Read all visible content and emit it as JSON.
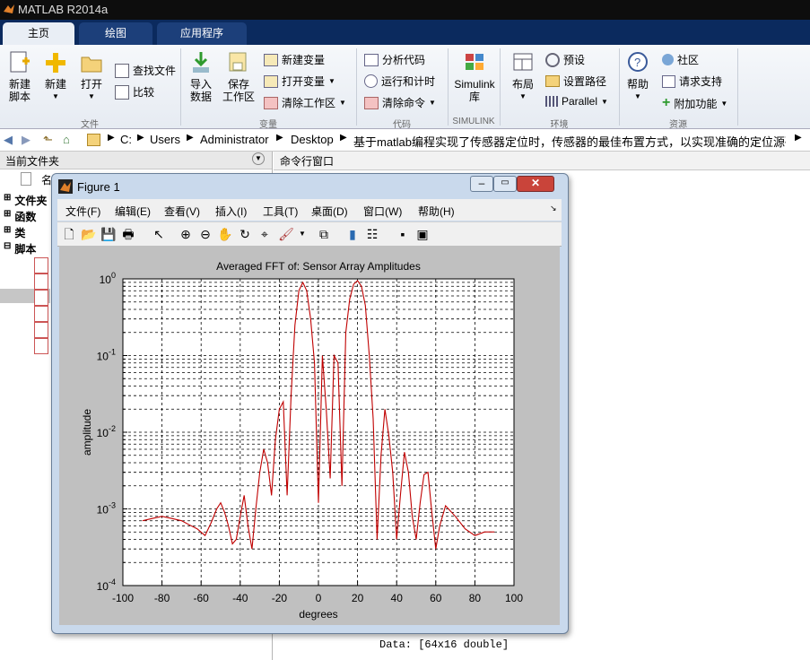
{
  "app": {
    "title": "MATLAB R2014a"
  },
  "tabs": [
    "主页",
    "绘图",
    "应用程序"
  ],
  "ribbon": {
    "file": {
      "new_script": "新建\n脚本",
      "new": "新建",
      "open": "打开",
      "find_files": "查找文件",
      "compare": "比较",
      "group": "文件"
    },
    "variable": {
      "import": "导入\n数据",
      "save_ws": "保存\n工作区",
      "new_var": "新建变量",
      "open_var": "打开变量",
      "clear_ws": "清除工作区",
      "group": "变量"
    },
    "code": {
      "analyze": "分析代码",
      "run_time": "运行和计时",
      "clear_cmd": "清除命令",
      "group": "代码"
    },
    "simulink": {
      "lib": "Simulink\n库",
      "group": "SIMULINK"
    },
    "env": {
      "layout": "布局",
      "prefs": "预设",
      "set_path": "设置路径",
      "parallel": "Parallel",
      "group": "环境"
    },
    "resources": {
      "help": "帮助",
      "community": "社区",
      "support": "请求支持",
      "addons": "附加功能",
      "group": "资源"
    }
  },
  "address": {
    "parts": [
      "C:",
      "Users",
      "Administrator",
      "Desktop",
      "基于matlab编程实现了传感器定位时，传感器的最佳布置方式，以实现准确的定位源码程序"
    ]
  },
  "left_panel": {
    "title": "当前文件夹",
    "col_name": "名",
    "tree": [
      "文件夹",
      "函数",
      "类",
      "脚本"
    ]
  },
  "command_window": {
    "title": "命令行窗口",
    "output": "Data: [64x16 double]"
  },
  "figure": {
    "title": "Figure 1",
    "menu": [
      "文件(F)",
      "编辑(E)",
      "查看(V)",
      "插入(I)",
      "工具(T)",
      "桌面(D)",
      "窗口(W)",
      "帮助(H)"
    ]
  },
  "chart_data": {
    "type": "line",
    "title": "Averaged FFT of: Sensor Array Amplitudes",
    "xlabel": "degrees",
    "ylabel": "amplitude",
    "xlim": [
      -100,
      100
    ],
    "ylim": [
      0.0001,
      1
    ],
    "yscale": "log",
    "grid": true,
    "xticks": [
      -100,
      -80,
      -60,
      -40,
      -20,
      0,
      20,
      40,
      60,
      80,
      100
    ],
    "yticks": [
      "10^0",
      "10^-1",
      "10^-2",
      "10^-3",
      "10^-4"
    ],
    "series": [
      {
        "color": "#c00000",
        "x": [
          -90,
          -85,
          -80,
          -75,
          -70,
          -66,
          -62,
          -58,
          -55,
          -52,
          -50,
          -48,
          -46,
          -44,
          -42,
          -40,
          -38,
          -36,
          -34,
          -32,
          -30,
          -28,
          -26,
          -24,
          -22,
          -20,
          -18,
          -16,
          -14,
          -12,
          -10,
          -8,
          -6,
          -4,
          -2,
          0,
          2,
          4,
          6,
          8,
          10,
          12,
          14,
          16,
          18,
          20,
          22,
          24,
          26,
          28,
          30,
          32,
          34,
          36,
          38,
          40,
          42,
          44,
          46,
          48,
          50,
          52,
          54,
          56,
          58,
          60,
          62,
          65,
          70,
          75,
          80,
          85,
          90
        ],
        "y": [
          0.0007,
          0.00075,
          0.0008,
          0.00075,
          0.0007,
          0.00062,
          0.00055,
          0.00045,
          0.00065,
          0.001,
          0.0012,
          0.0009,
          0.0006,
          0.00035,
          0.0004,
          0.0008,
          0.0015,
          0.0006,
          0.0003,
          0.001,
          0.003,
          0.006,
          0.004,
          0.0015,
          0.008,
          0.02,
          0.025,
          0.0015,
          0.03,
          0.25,
          0.7,
          0.9,
          0.7,
          0.3,
          0.08,
          0.0012,
          0.1,
          0.02,
          0.0025,
          0.1,
          0.08,
          0.002,
          0.2,
          0.55,
          0.85,
          0.95,
          0.8,
          0.45,
          0.1,
          0.015,
          0.0004,
          0.005,
          0.02,
          0.009,
          0.003,
          0.0004,
          0.0016,
          0.0055,
          0.003,
          0.0008,
          0.0004,
          0.0012,
          0.0028,
          0.003,
          0.0009,
          0.0003,
          0.0006,
          0.0011,
          0.0008,
          0.00055,
          0.00045,
          0.0005,
          0.0005
        ]
      }
    ]
  }
}
